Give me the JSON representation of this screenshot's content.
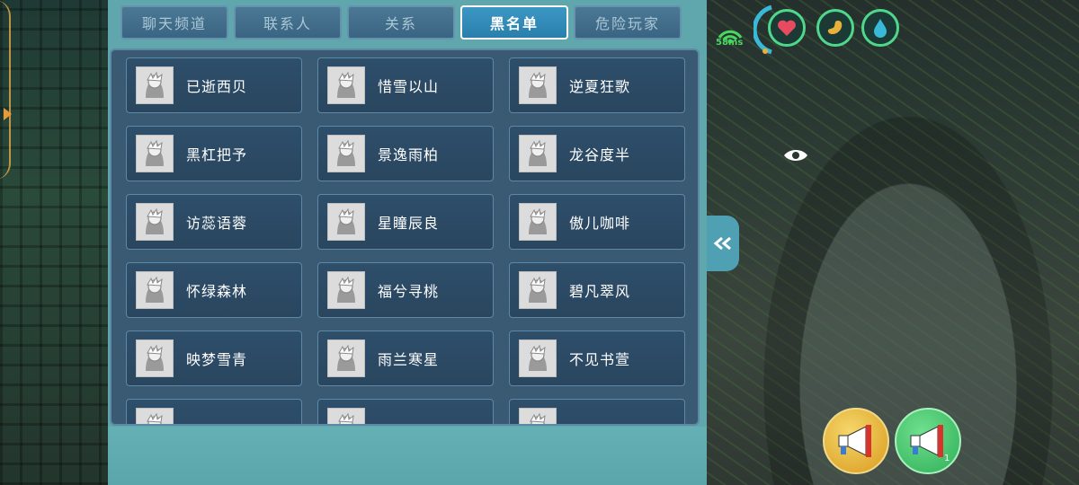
{
  "tabs": [
    {
      "label": "聊天频道",
      "active": false
    },
    {
      "label": "联系人",
      "active": false
    },
    {
      "label": "关系",
      "active": false
    },
    {
      "label": "黑名单",
      "active": true
    },
    {
      "label": "危险玩家",
      "active": false
    }
  ],
  "blacklist": [
    "已逝西贝",
    "惜雪以山",
    "逆夏狂歌",
    "黑杠把予",
    "景逸雨柏",
    "龙谷度半",
    "访蕊语蓉",
    "星瞳辰良",
    "傲儿咖啡",
    "怀绿森林",
    "福兮寻桃",
    "碧凡翠风",
    "映梦雪青",
    "雨兰寒星",
    "不见书萱"
  ],
  "hud": {
    "ping": "58ms",
    "status_icons": [
      "heart-icon",
      "stomach-icon",
      "water-drop-icon"
    ],
    "colors": {
      "ring": "#4fd88b",
      "heart": "#e84a5f",
      "food": "#e8b23a",
      "water": "#3ab8d8"
    }
  },
  "megaphone_badge": "1",
  "colors": {
    "panel": "#5fa6ad",
    "tab_active": "#2a7fab",
    "cell": "#2e4e6a"
  }
}
